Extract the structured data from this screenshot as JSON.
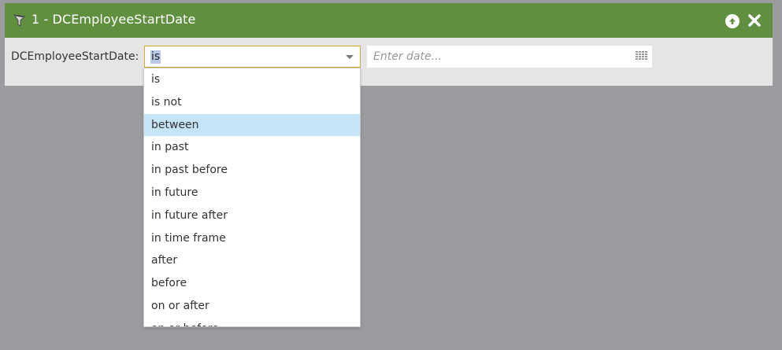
{
  "panel": {
    "title": "1 - DCEmployeeStartDate",
    "icons": {
      "funnel": "funnel-icon",
      "move_up": "arrow-up-circle-icon",
      "close": "close-icon"
    }
  },
  "filter": {
    "label": "DCEmployeeStartDate:",
    "operator_selected": "is",
    "date_placeholder": "Enter date...",
    "date_value": ""
  },
  "dropdown": {
    "highlighted": "between",
    "options": [
      "is",
      "is not",
      "between",
      "in past",
      "in past before",
      "in future",
      "in future after",
      "in time frame",
      "after",
      "before",
      "on or after",
      "on or before"
    ]
  },
  "colors": {
    "titlebar": "#5f8f3f",
    "highlight": "#c5e4f7",
    "select_border": "#d9a640",
    "backdrop": "#9c9b9f"
  }
}
